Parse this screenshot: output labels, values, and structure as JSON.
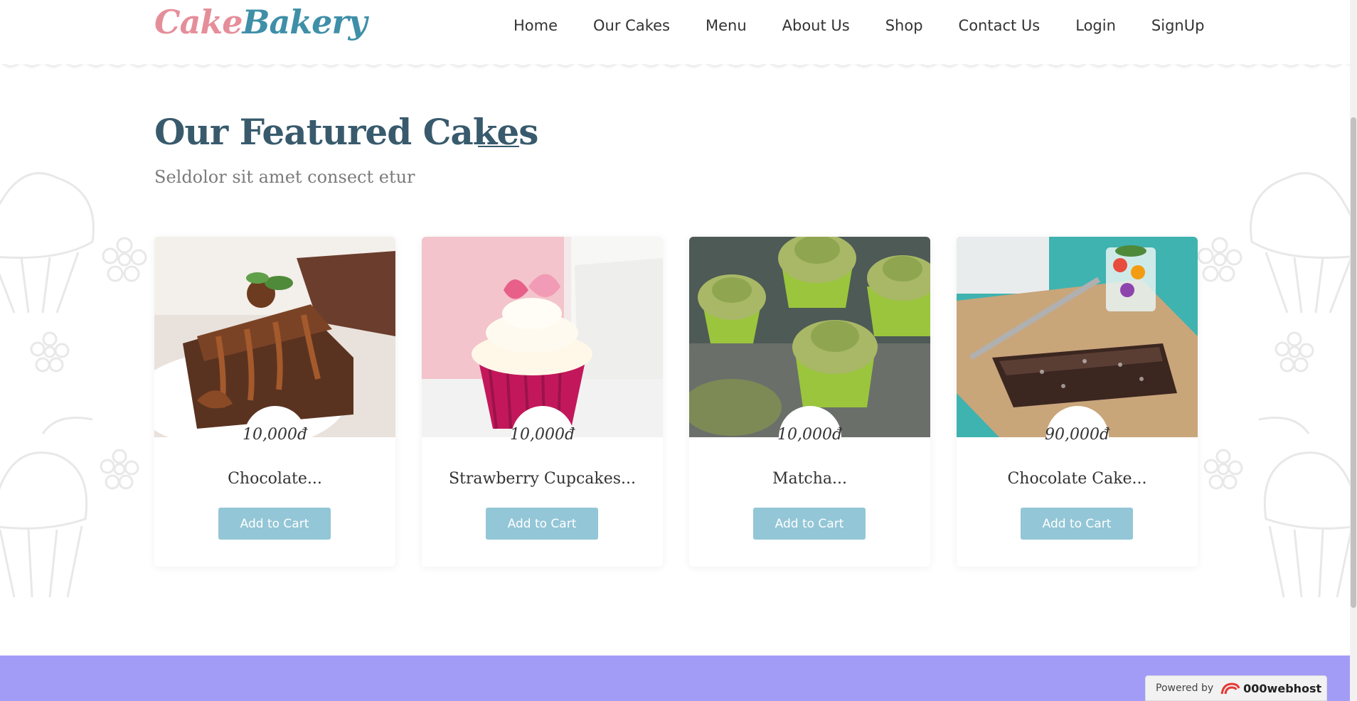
{
  "header": {
    "logo_part1": "Cake",
    "logo_part2": "Bakery",
    "nav": [
      "Home",
      "Our Cakes",
      "Menu",
      "About Us",
      "Shop",
      "Contact Us",
      "Login",
      "SignUp"
    ]
  },
  "featured": {
    "title": "Our Featured Cakes",
    "subtitle": "Seldolor sit amet consect etur",
    "cards": [
      {
        "price": "10,000đ",
        "name": "Chocolate...",
        "button": "Add to Cart",
        "image": "chocolate-slice-image"
      },
      {
        "price": "10,000đ",
        "name": "Strawberry Cupcakes...",
        "button": "Add to Cart",
        "image": "strawberry-cupcake-image"
      },
      {
        "price": "10,000đ",
        "name": "Matcha...",
        "button": "Add to Cart",
        "image": "matcha-cupcakes-image"
      },
      {
        "price": "90,000đ",
        "name": "Chocolate Cake...",
        "button": "Add to Cart",
        "image": "chocolate-cake-image"
      }
    ]
  },
  "footer": {
    "powered_by": "Powered by",
    "brand": "000webhost"
  },
  "colors": {
    "logo_pink": "#e58e9a",
    "logo_teal": "#3f8fa8",
    "heading": "#385a6c",
    "button": "#93c6d6",
    "footer_band": "#a29cf7"
  }
}
